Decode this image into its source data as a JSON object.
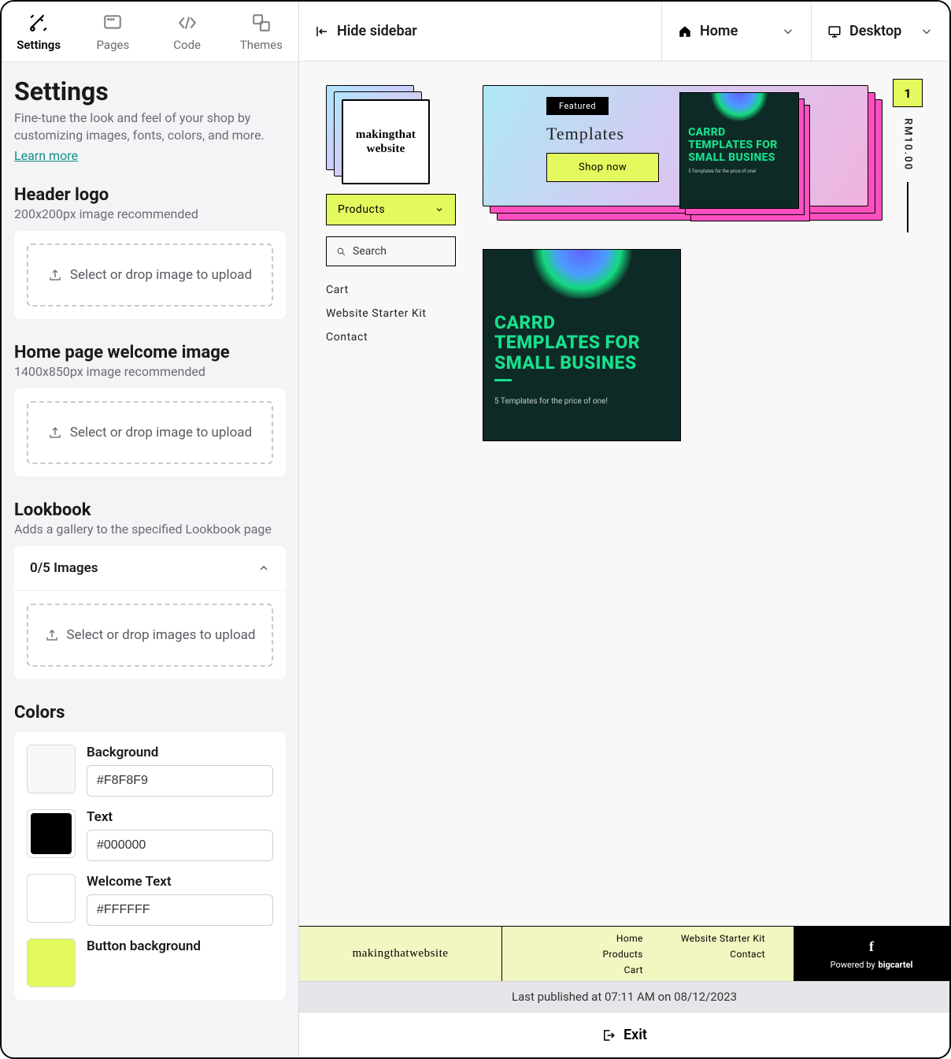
{
  "tabs": {
    "settings": "Settings",
    "pages": "Pages",
    "code": "Code",
    "themes": "Themes"
  },
  "panel": {
    "title": "Settings",
    "desc": "Fine-tune the look and feel of your shop by customizing images, fonts, colors, and more.",
    "learn_more": "Learn more"
  },
  "sections": {
    "header_logo": {
      "title": "Header logo",
      "sub": "200x200px image recommended",
      "drop": "Select or drop image to upload"
    },
    "welcome_image": {
      "title": "Home page welcome image",
      "sub": "1400x850px image recommended",
      "drop": "Select or drop image to upload"
    },
    "lookbook": {
      "title": "Lookbook",
      "sub": "Adds a gallery to the specified Lookbook page",
      "count": "0/5 Images",
      "drop": "Select or drop images to upload"
    },
    "colors": {
      "title": "Colors",
      "items": [
        {
          "label": "Background",
          "value": "#F8F8F9",
          "swatch": "#F8F8F9"
        },
        {
          "label": "Text",
          "value": "#000000",
          "swatch": "#000000"
        },
        {
          "label": "Welcome Text",
          "value": "#FFFFFF",
          "swatch": "#FFFFFF"
        },
        {
          "label": "Button background",
          "value": "",
          "swatch": "#E4F95E"
        }
      ]
    }
  },
  "topbar": {
    "hide": "Hide sidebar",
    "home": "Home",
    "desktop": "Desktop"
  },
  "preview": {
    "logo_text": "makingthat website",
    "products": "Products",
    "search": "Search",
    "nav": [
      "Cart",
      "Website Starter Kit",
      "Contact"
    ],
    "hero": {
      "badge": "Featured",
      "title": "Templates",
      "cta": "Shop now"
    },
    "carrd": {
      "line1": "CARRD",
      "line2": "TEMPLATES FOR",
      "line3": "SMALL BUSINES",
      "sub": "5 Templates for the price of one!"
    },
    "product": {
      "line1": "CARRD",
      "line2": "TEMPLATES FOR",
      "line3": "SMALL BUSINES",
      "sub": "5 Templates for the price of one!"
    },
    "cart": {
      "count": "1",
      "price": "RM10.00"
    },
    "footer": {
      "brand": "makingthatwebsite",
      "links": [
        "Home",
        "Website Starter Kit",
        "Products",
        "Contact",
        "Cart",
        ""
      ],
      "powered": "Powered by",
      "bigcartel": "bigcartel"
    }
  },
  "publish": "Last published at 07:11 AM on 08/12/2023",
  "exit": "Exit"
}
